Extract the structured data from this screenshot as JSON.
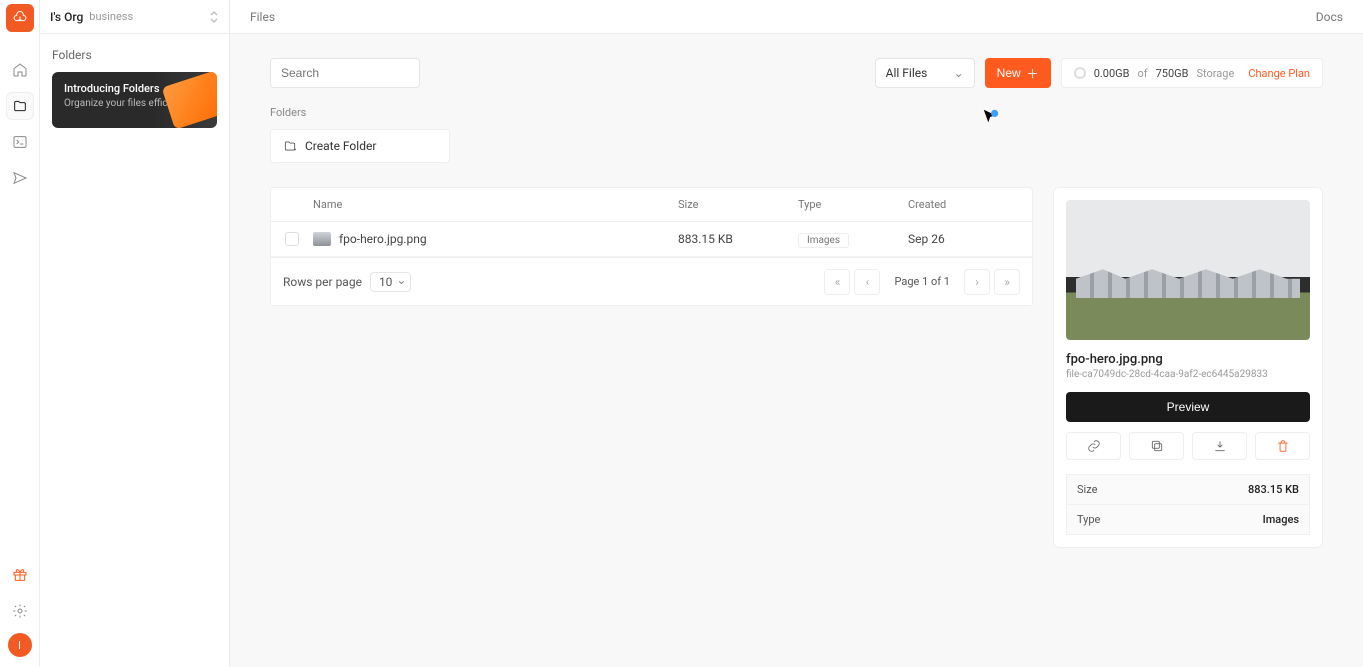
{
  "header": {
    "org_name": "I's Org",
    "plan": "business",
    "breadcrumb": "Files",
    "docs_link": "Docs"
  },
  "sidebar": {
    "section_label": "Folders",
    "promo": {
      "title": "Introducing Folders",
      "subtitle": "Organize your files efficiently."
    }
  },
  "rail": {
    "avatar_initial": "I"
  },
  "toolbar": {
    "search_placeholder": "Search",
    "filter_value": "All Files",
    "new_button": "New",
    "storage": {
      "used": "0.00GB",
      "of": "of",
      "total": "750GB",
      "label": "Storage",
      "change_plan": "Change Plan"
    }
  },
  "folders": {
    "heading": "Folders",
    "create_label": "Create Folder"
  },
  "table": {
    "columns": {
      "name": "Name",
      "size": "Size",
      "type": "Type",
      "created": "Created"
    },
    "rows": [
      {
        "name": "fpo-hero.jpg.png",
        "size": "883.15 KB",
        "type": "Images",
        "created": "Sep 26"
      }
    ]
  },
  "details": {
    "filename": "fpo-hero.jpg.png",
    "file_id": "file-ca7049dc-28cd-4caa-9af2-ec6445a29833",
    "preview_button": "Preview",
    "meta": {
      "size_label": "Size",
      "size_value": "883.15 KB",
      "type_label": "Type",
      "type_value": "Images"
    }
  },
  "pagination": {
    "rows_per_page_label": "Rows per page",
    "rows_per_page_value": "10",
    "page_label": "Page 1 of 1"
  }
}
